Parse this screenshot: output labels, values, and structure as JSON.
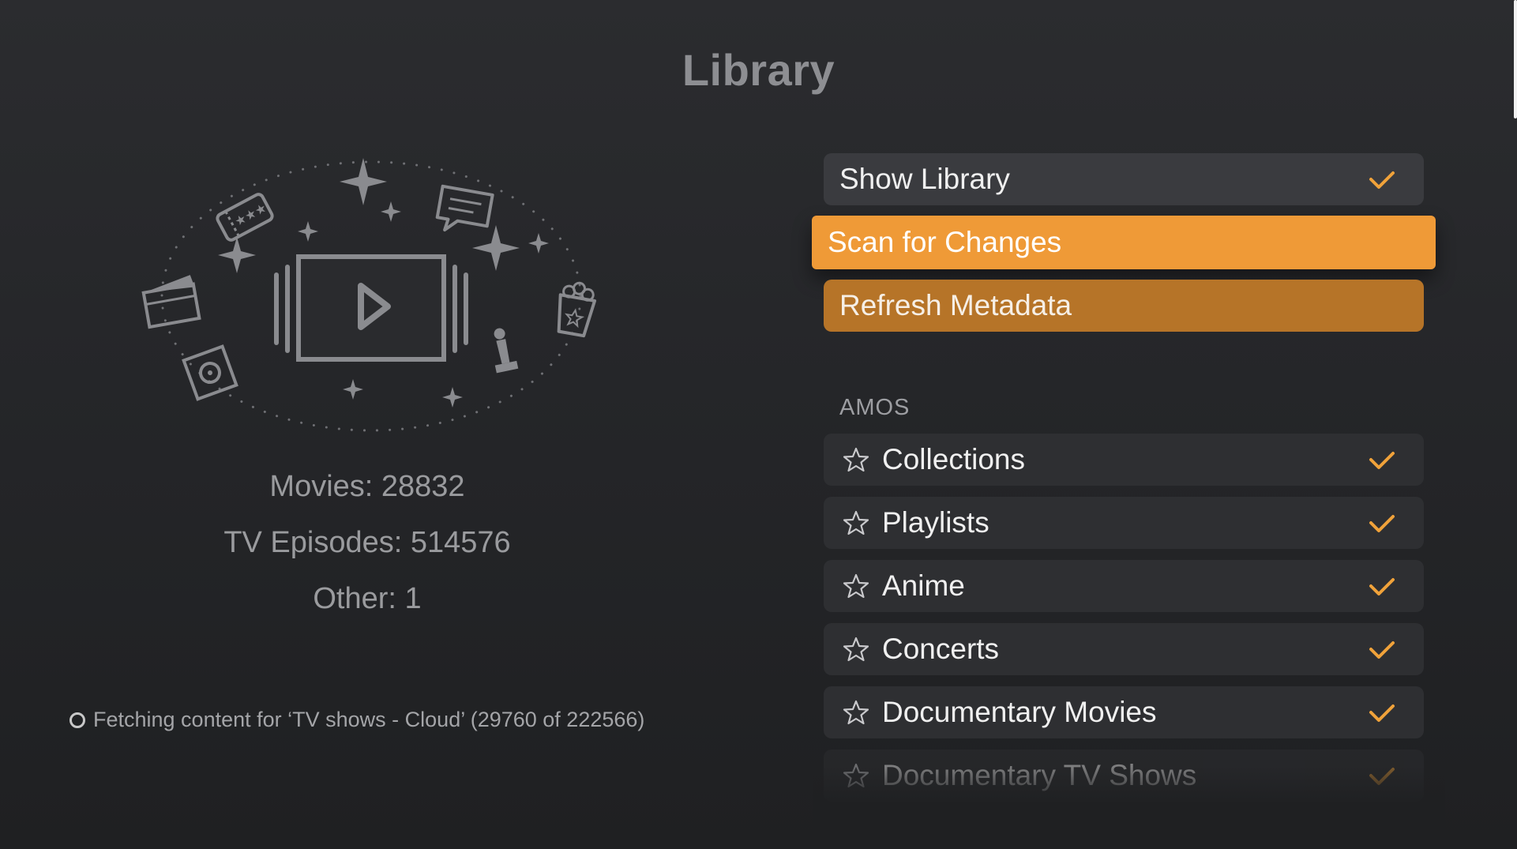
{
  "page": {
    "title": "Library"
  },
  "stats": {
    "movies": "Movies: 28832",
    "tv_episodes": "TV Episodes: 514576",
    "other": "Other: 1"
  },
  "status": {
    "text": "Fetching content for ‘TV shows - Cloud’ (29760 of 222566)"
  },
  "menu": {
    "show_library": {
      "label": "Show Library",
      "checked": true
    },
    "scan_for_changes": {
      "label": "Scan for Changes"
    },
    "refresh_metadata": {
      "label": "Refresh Metadata"
    }
  },
  "section": {
    "label": "AMOS",
    "items": [
      {
        "label": "Collections",
        "checked": true
      },
      {
        "label": "Playlists",
        "checked": true
      },
      {
        "label": "Anime",
        "checked": true
      },
      {
        "label": "Concerts",
        "checked": true
      },
      {
        "label": "Documentary Movies",
        "checked": true
      },
      {
        "label": "Documentary TV Shows",
        "checked": true
      }
    ]
  },
  "colors": {
    "accent": "#ef9a37",
    "refresh": "#b67428",
    "check": "#f0a23a",
    "row_bg": "#2e2f32",
    "background": "#252629"
  },
  "icons": [
    "play-icon",
    "ticket-icon",
    "clapperboard-icon",
    "film-reel-icon",
    "speech-bubble-icon",
    "popcorn-icon",
    "award-statue-icon",
    "sparkle-icon",
    "star-icon",
    "checkmark-icon",
    "spinner-icon"
  ]
}
